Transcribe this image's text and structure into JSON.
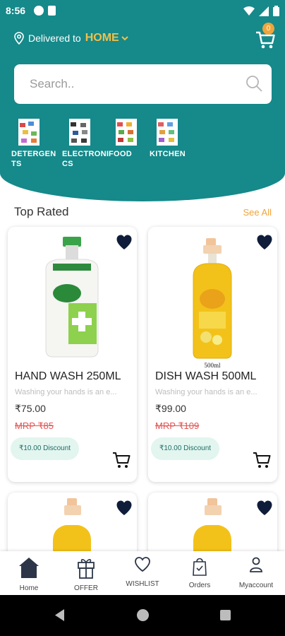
{
  "status_bar": {
    "time": "8:56"
  },
  "location": {
    "label": "Delivered to",
    "value": "HOME"
  },
  "cart": {
    "count": "0"
  },
  "search": {
    "placeholder": "Search.."
  },
  "categories": [
    {
      "label": "DETERGEN TS"
    },
    {
      "label": "ELECTRONI CS"
    },
    {
      "label": "FOOD"
    },
    {
      "label": "KITCHEN"
    }
  ],
  "section": {
    "title": "Top Rated",
    "see_all": "See All"
  },
  "products": [
    {
      "name": "HAND WASH 250ML",
      "desc": "Washing your hands is an e...",
      "price": "₹75.00",
      "mrp": "MRP ₹85",
      "discount": "₹10.00 Discount"
    },
    {
      "name": "DISH WASH 500ML",
      "desc": "Washing your hands is an e...",
      "price": "₹99.00",
      "mrp": "MRP ₹109",
      "discount": "₹10.00 Discount"
    }
  ],
  "bottom_nav": [
    {
      "label": "Home"
    },
    {
      "label": "OFFER"
    },
    {
      "label": "WISHLIST"
    },
    {
      "label": "Orders"
    },
    {
      "label": "Myaccount"
    }
  ],
  "colors": {
    "teal": "#16898a",
    "accent": "#f0a43a",
    "heart": "#0f1d3a"
  },
  "label_500ml": "500ml"
}
